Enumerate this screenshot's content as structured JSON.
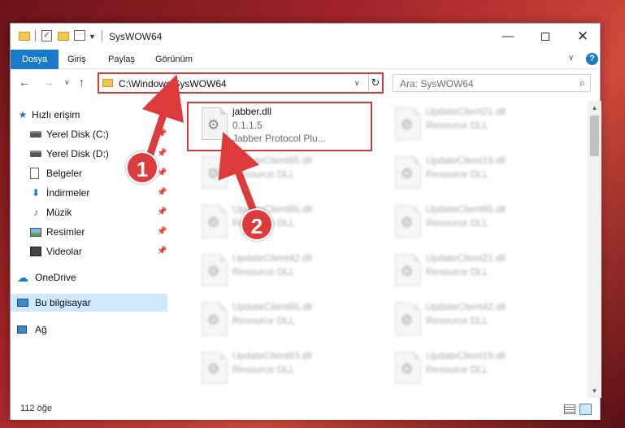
{
  "window": {
    "title": "SysWOW64",
    "minimize": "—",
    "close": "✕"
  },
  "ribbon": {
    "tabs": [
      "Dosya",
      "Giriş",
      "Paylaş",
      "Görünüm"
    ],
    "help": "?"
  },
  "navigation": {
    "address": "C:\\Windows\\SysWOW64",
    "search_placeholder": "Ara: SysWOW64"
  },
  "sidebar": {
    "quick_access": "Hızlı erişim",
    "items": [
      {
        "label": "Yerel Disk (C:)",
        "icon": "disk-icon"
      },
      {
        "label": "Yerel Disk (D:)",
        "icon": "disk-icon"
      },
      {
        "label": "Belgeler",
        "icon": "documents-icon"
      },
      {
        "label": "İndirmeler",
        "icon": "download-icon"
      },
      {
        "label": "Müzik",
        "icon": "music-icon"
      },
      {
        "label": "Resimler",
        "icon": "pictures-icon"
      },
      {
        "label": "Videolar",
        "icon": "videos-icon"
      }
    ],
    "onedrive": "OneDrive",
    "this_pc": "Bu bilgisayar",
    "network": "Ağ"
  },
  "files": [
    {
      "name": "jabber.dll",
      "version": "0.1.1.5",
      "description": "Jabber Protocol Plu...",
      "highlighted": true
    },
    {
      "name": "UpdateClient21.dll",
      "version": "Resource DLL"
    },
    {
      "name": "UpdateClient65.dll",
      "version": "Resource DLL"
    },
    {
      "name": "UpdateClient19.dll",
      "version": "Resource DLL"
    },
    {
      "name": "UpdateClient65.dll",
      "version": "Resource DLL"
    },
    {
      "name": "UpdateClient65.dll",
      "version": "Resource DLL"
    },
    {
      "name": "UpdateClient42.dll",
      "version": "Resource DLL"
    },
    {
      "name": "UpdateClient21.dll",
      "version": "Resource DLL"
    },
    {
      "name": "UpdateClient65.dll",
      "version": "Resource DLL"
    },
    {
      "name": "UpdateClient42.dll",
      "version": "Resource DLL"
    },
    {
      "name": "UpdateClient63.dll",
      "version": "Resource DLL"
    },
    {
      "name": "UpdateClient19.dll",
      "version": "Resource DLL"
    }
  ],
  "status": {
    "count": "112 öğe"
  },
  "annotations": {
    "step1": "1",
    "step2": "2",
    "color": "#dd3b3b"
  }
}
